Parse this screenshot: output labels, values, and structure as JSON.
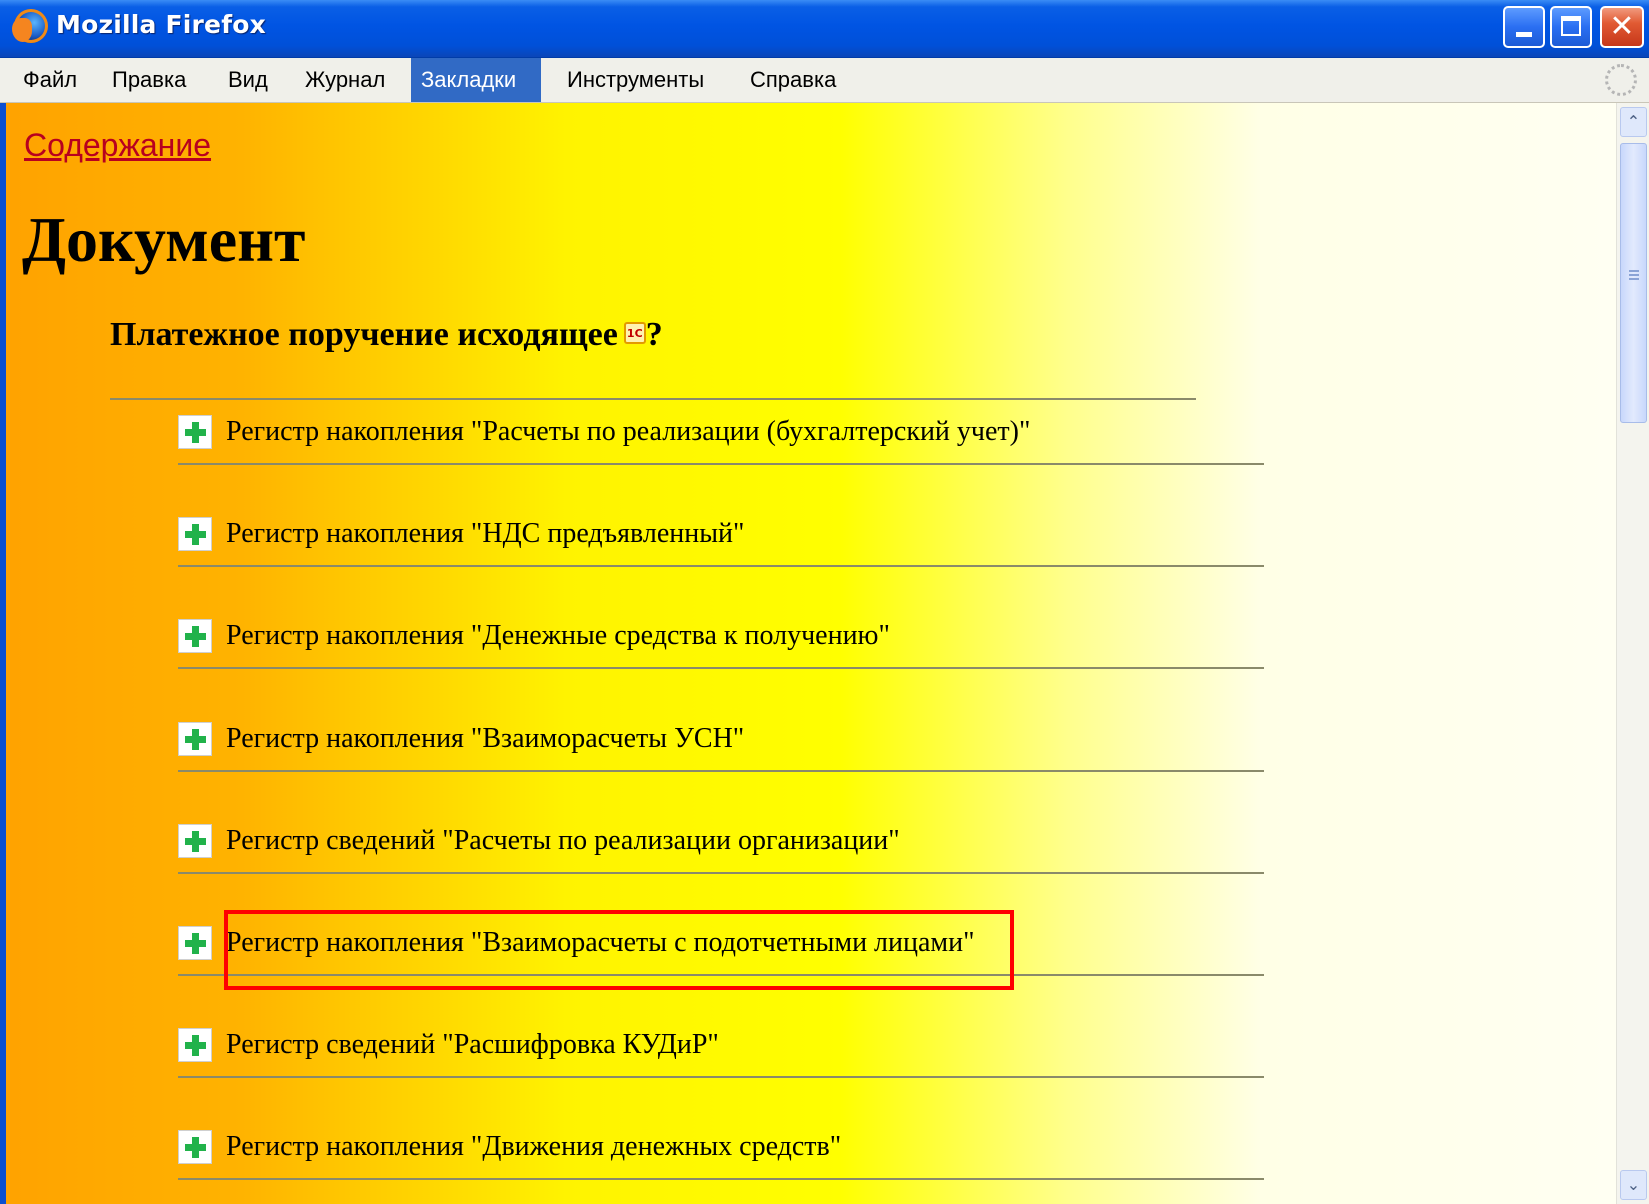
{
  "window": {
    "title": "Mozilla Firefox",
    "close_glyph": "✕"
  },
  "menu": {
    "items": [
      {
        "label": "Файл"
      },
      {
        "label": "Правка"
      },
      {
        "label": "Вид"
      },
      {
        "label": "Журнал"
      },
      {
        "label": "Закладки",
        "active": true
      },
      {
        "label": "Инструменты"
      },
      {
        "label": "Справка"
      }
    ]
  },
  "page": {
    "toc_link": "Содержание",
    "title": "Документ",
    "subtitle": "Платежное поручение исходящее",
    "onec_badge": "1С",
    "help_mark": "?",
    "registers": [
      {
        "label": "Регистр накопления \"Расчеты по реализации (бухгалтерский учет)\""
      },
      {
        "label": "Регистр накопления \"НДС предъявленный\""
      },
      {
        "label": "Регистр накопления \"Денежные средства к получению\""
      },
      {
        "label": "Регистр накопления \"Взаиморасчеты УСН\""
      },
      {
        "label": "Регистр сведений \"Расчеты по реализации организации\""
      },
      {
        "label": "Регистр накопления \"Взаиморасчеты с подотчетными лицами\"",
        "highlighted": true
      },
      {
        "label": "Регистр сведений \"Расшифровка КУДиР\""
      },
      {
        "label": "Регистр накопления \"Движения денежных средств\""
      }
    ]
  },
  "scrollbar": {
    "up_glyph": "⌃",
    "down_glyph": "⌄"
  },
  "colors": {
    "titlebar": "#0054e3",
    "menu_active": "#316ac5",
    "link": "#b8001f",
    "highlight": "#ff0000",
    "plus": "#21b24a"
  }
}
